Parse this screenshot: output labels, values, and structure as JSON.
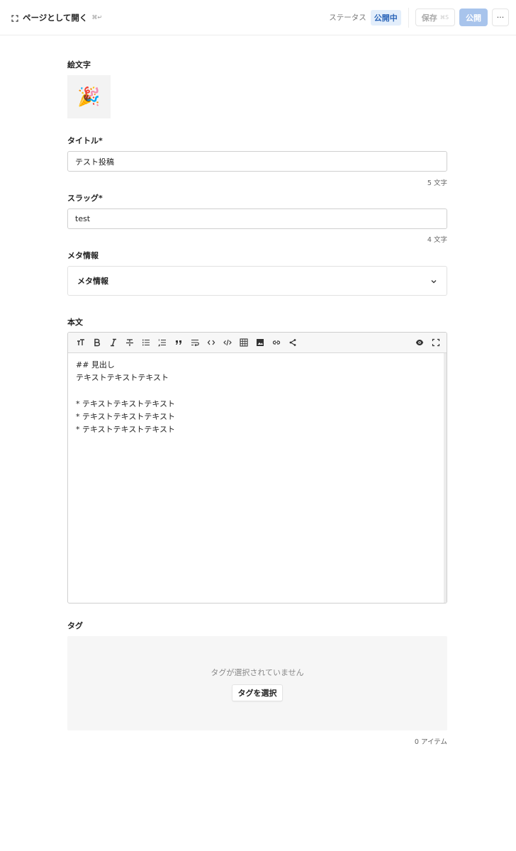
{
  "header": {
    "open_page_label": "ページとして開く",
    "open_page_shortcut": "⌘↵",
    "status_label": "ステータス",
    "status_value": "公開中",
    "save_label": "保存",
    "save_shortcut": "⌘S",
    "publish_label": "公開",
    "more_label": "···"
  },
  "emoji": {
    "label": "絵文字",
    "value": "🎉"
  },
  "title": {
    "label": "タイトル*",
    "value": "テスト投稿",
    "counter": "5 文字"
  },
  "slug": {
    "label": "スラッグ*",
    "value": "test",
    "counter": "4 文字"
  },
  "meta": {
    "label": "メタ情報",
    "accordion_label": "メタ情報"
  },
  "body": {
    "label": "本文",
    "toolbar_icons": [
      "text-size-icon",
      "bold-icon",
      "italic-icon",
      "strikethrough-icon",
      "bullet-list-icon",
      "numbered-list-icon",
      "quote-icon",
      "wrap-icon",
      "code-icon",
      "code-block-icon",
      "table-icon",
      "image-icon",
      "link-icon",
      "share-icon",
      "preview-icon",
      "fullscreen-icon"
    ],
    "lines": [
      "## 見出し",
      "テキストテキストテキスト",
      "",
      "* テキストテキストテキスト",
      "* テキストテキストテキスト",
      "* テキストテキストテキスト"
    ]
  },
  "tags": {
    "label": "タグ",
    "empty_text": "タグが選択されていません",
    "select_button": "タグを選択",
    "counter": "0 アイテム"
  }
}
